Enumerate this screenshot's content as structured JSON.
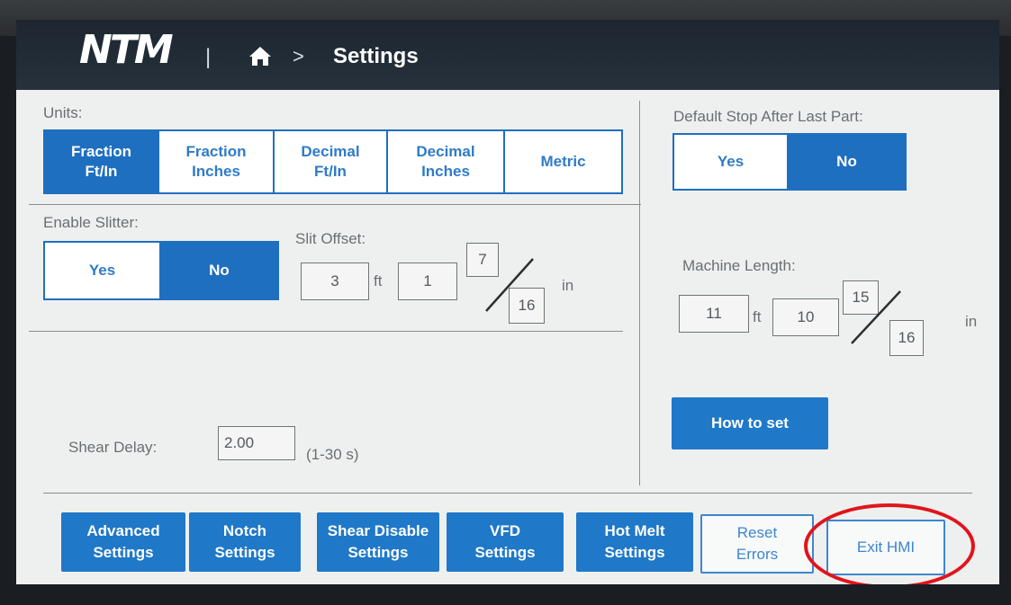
{
  "header": {
    "logo": "NTM",
    "separator": "|",
    "breadcrumb_chevron": ">",
    "title": "Settings",
    "home_icon": "home-icon"
  },
  "units": {
    "label": "Units:",
    "options": [
      "Fraction\nFt/In",
      "Fraction\nInches",
      "Decimal\nFt/In",
      "Decimal\nInches",
      "Metric"
    ],
    "selected": "Fraction\nFt/In"
  },
  "slitter": {
    "label": "Enable Slitter:",
    "yes": "Yes",
    "no": "No",
    "selected": "No"
  },
  "slit_offset": {
    "label": "Slit Offset:",
    "feet": "3",
    "feet_unit": "ft",
    "inches": "1",
    "numerator": "7",
    "denominator": "16",
    "inch_unit": "in"
  },
  "shear_delay": {
    "label": "Shear Delay:",
    "value": "2.00",
    "range": "(1-30 s)"
  },
  "default_stop": {
    "label": "Default Stop After Last Part:",
    "yes": "Yes",
    "no": "No",
    "selected": "No"
  },
  "machine_length": {
    "label": "Machine Length:",
    "feet": "11",
    "feet_unit": "ft",
    "inches": "10",
    "numerator": "15",
    "denominator": "16",
    "inch_unit": "in"
  },
  "how_to_set": "How to set",
  "footer_buttons": {
    "advanced": "Advanced\nSettings",
    "notch": "Notch\nSettings",
    "shear_disable": "Shear Disable\nSettings",
    "vfd": "VFD\nSettings",
    "hot_melt": "Hot Melt\nSettings",
    "reset_errors": "Reset\nErrors",
    "exit_hmi": "Exit HMI"
  },
  "colors": {
    "accent": "#1f78c8",
    "header_bg": "#1d2630",
    "screen_bg": "#eef0ef",
    "highlight_circle": "#e1141c"
  }
}
